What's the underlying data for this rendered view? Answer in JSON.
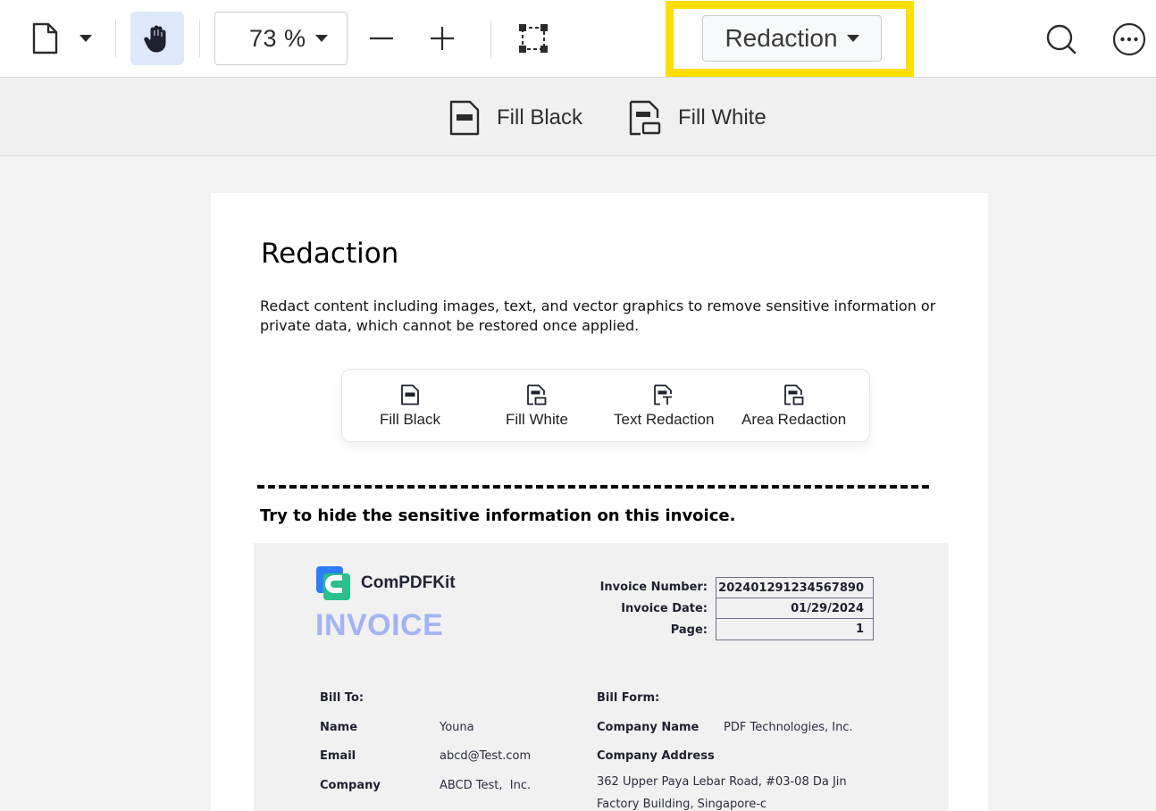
{
  "toolbar": {
    "zoom": "73 %",
    "mode": "Redaction"
  },
  "subbar": {
    "fill_black": "Fill Black",
    "fill_white": "Fill White"
  },
  "page": {
    "title": "Redaction",
    "description": "Redact content including images, text, and vector graphics to remove sensitive information or private data, which cannot be restored once applied.",
    "tools": [
      "Fill Black",
      "Fill White",
      "Text Redaction",
      "Area Redaction"
    ],
    "prompt": "Try to hide the sensitive information on this invoice."
  },
  "invoice": {
    "brand": "ComPDFKit",
    "heading": "INVOICE",
    "meta_labels": [
      "Invoice Number:",
      "Invoice Date:",
      "Page:"
    ],
    "meta_values": [
      "202401291234567890",
      "01/29/2024",
      "1"
    ],
    "bill_to_label": "Bill To:",
    "bill_from_label": "Bill Form:",
    "name_label": "Name",
    "name_value": "Youna",
    "email_label": "Email",
    "email_value": "abcd@Test.com",
    "company_label": "Company",
    "company_value": "ABCD Test,  Inc.",
    "company_name_label": "Company Name",
    "company_name_value": "PDF Technologies, Inc.",
    "company_address_label": "Company Address",
    "address_line1": "362 Upper Paya Lebar Road, #03-08 Da Jin",
    "address_line2": "Factory Building, Singapore-c"
  },
  "colors": {
    "highlight": "#ffdf00",
    "hand_active_bg": "#dde8fb",
    "invoice_heading": "#a3b3f3",
    "brand_blue": "#2f7df6",
    "brand_green": "#2bbf8a"
  }
}
